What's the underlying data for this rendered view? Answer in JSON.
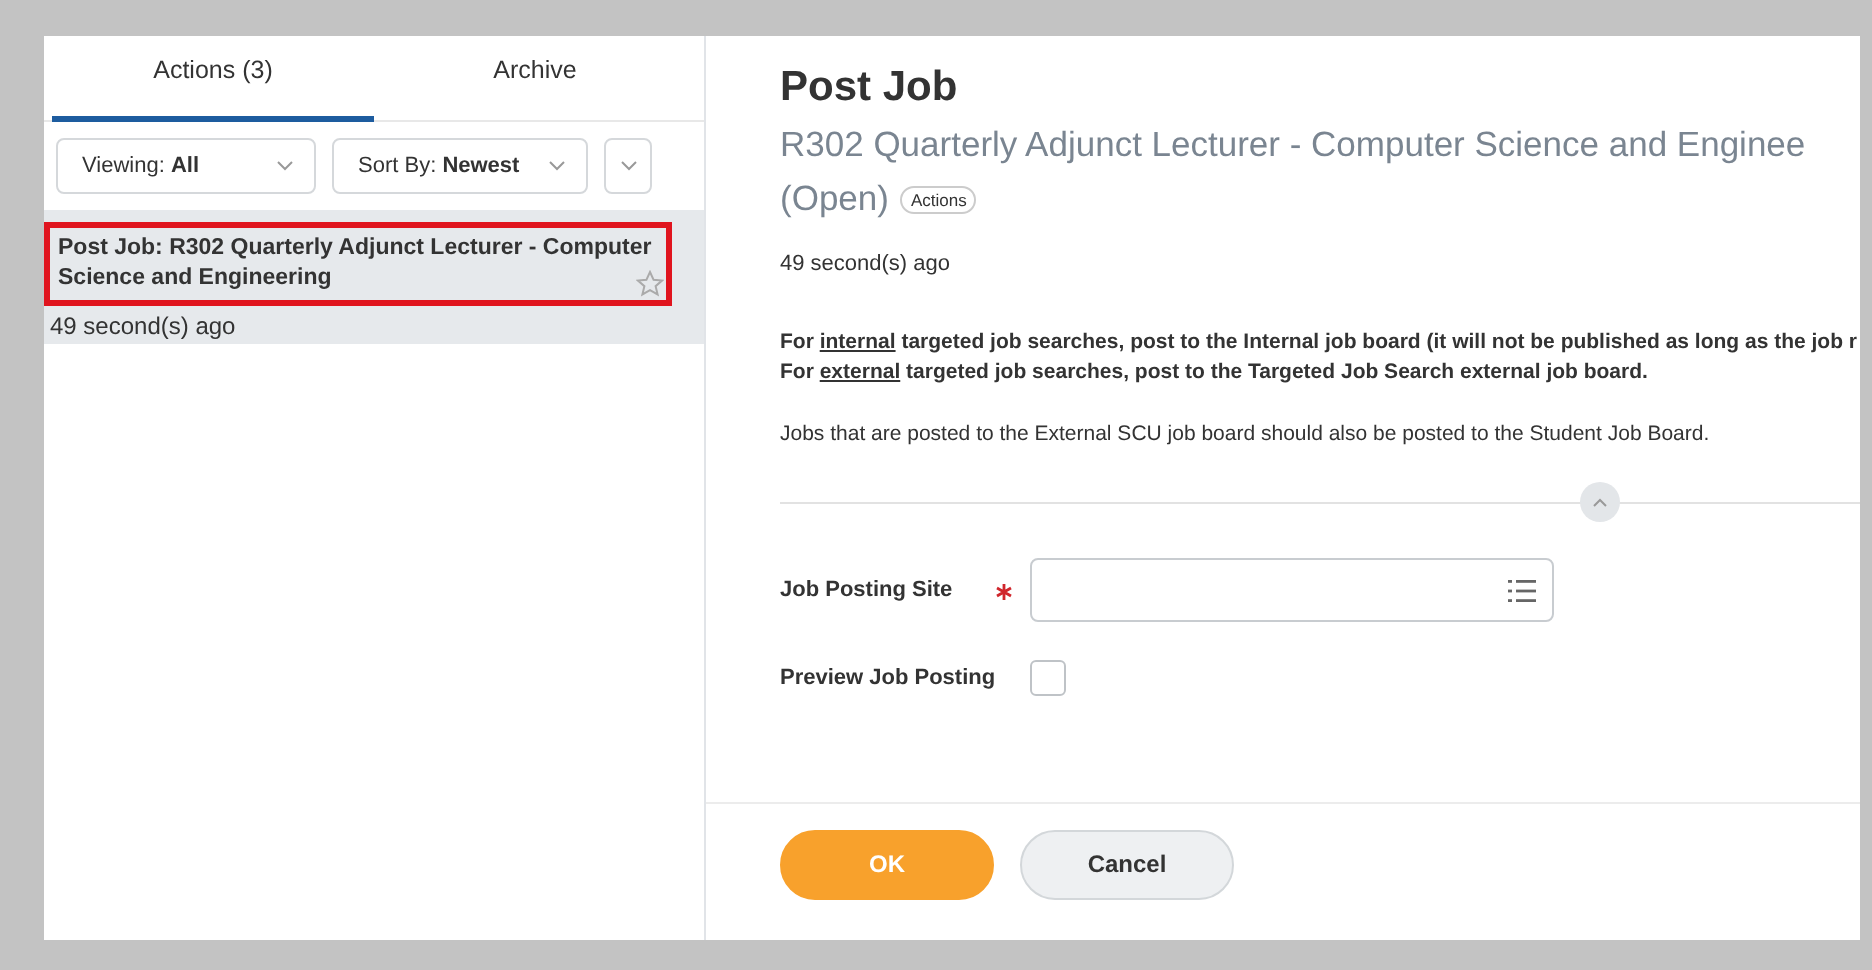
{
  "tabs": [
    {
      "label": "Actions (3)",
      "selected": true
    },
    {
      "label": "Archive",
      "selected": false
    }
  ],
  "filters": [
    {
      "label": "Viewing: **All**"
    },
    {
      "label": "Sort By: **Newest**"
    }
  ],
  "inbox_items": [
    {
      "title": "Post Job: R302 Quarterly Adjunct Lecturer - Computer Science and Engineering",
      "time": "49 second(s) ago",
      "selected": true,
      "highlighted": true
    }
  ],
  "task": {
    "title": "Post Job",
    "subtitle": "R302 Quarterly Adjunct Lecturer - Computer Science and Enginee",
    "status": "(Open)",
    "actions_label": "Actions",
    "time": "49 second(s) ago",
    "instructions": [
      [
        {
          "text": "For "
        },
        {
          "text": "internal",
          "underline": true
        },
        {
          "text": " targeted job searches, post to the Internal job board (it will not be published as long as the job r"
        }
      ],
      [
        {
          "text": "For "
        },
        {
          "text": "external",
          "underline": true
        },
        {
          "text": " targeted job searches, post to the Targeted Job Search external job board."
        }
      ]
    ],
    "note": "Jobs that are posted to the External SCU job board should also be posted to the Student Job Board.",
    "fields": [
      {
        "kind": "prompt",
        "label": "Job Posting Site",
        "required": true
      },
      {
        "kind": "checkbox",
        "label": "Preview Job Posting",
        "required": false,
        "checked": false
      }
    ]
  },
  "buttons": [
    {
      "label": "OK",
      "kind": "primary"
    },
    {
      "label": "Cancel",
      "kind": "secondary"
    }
  ]
}
